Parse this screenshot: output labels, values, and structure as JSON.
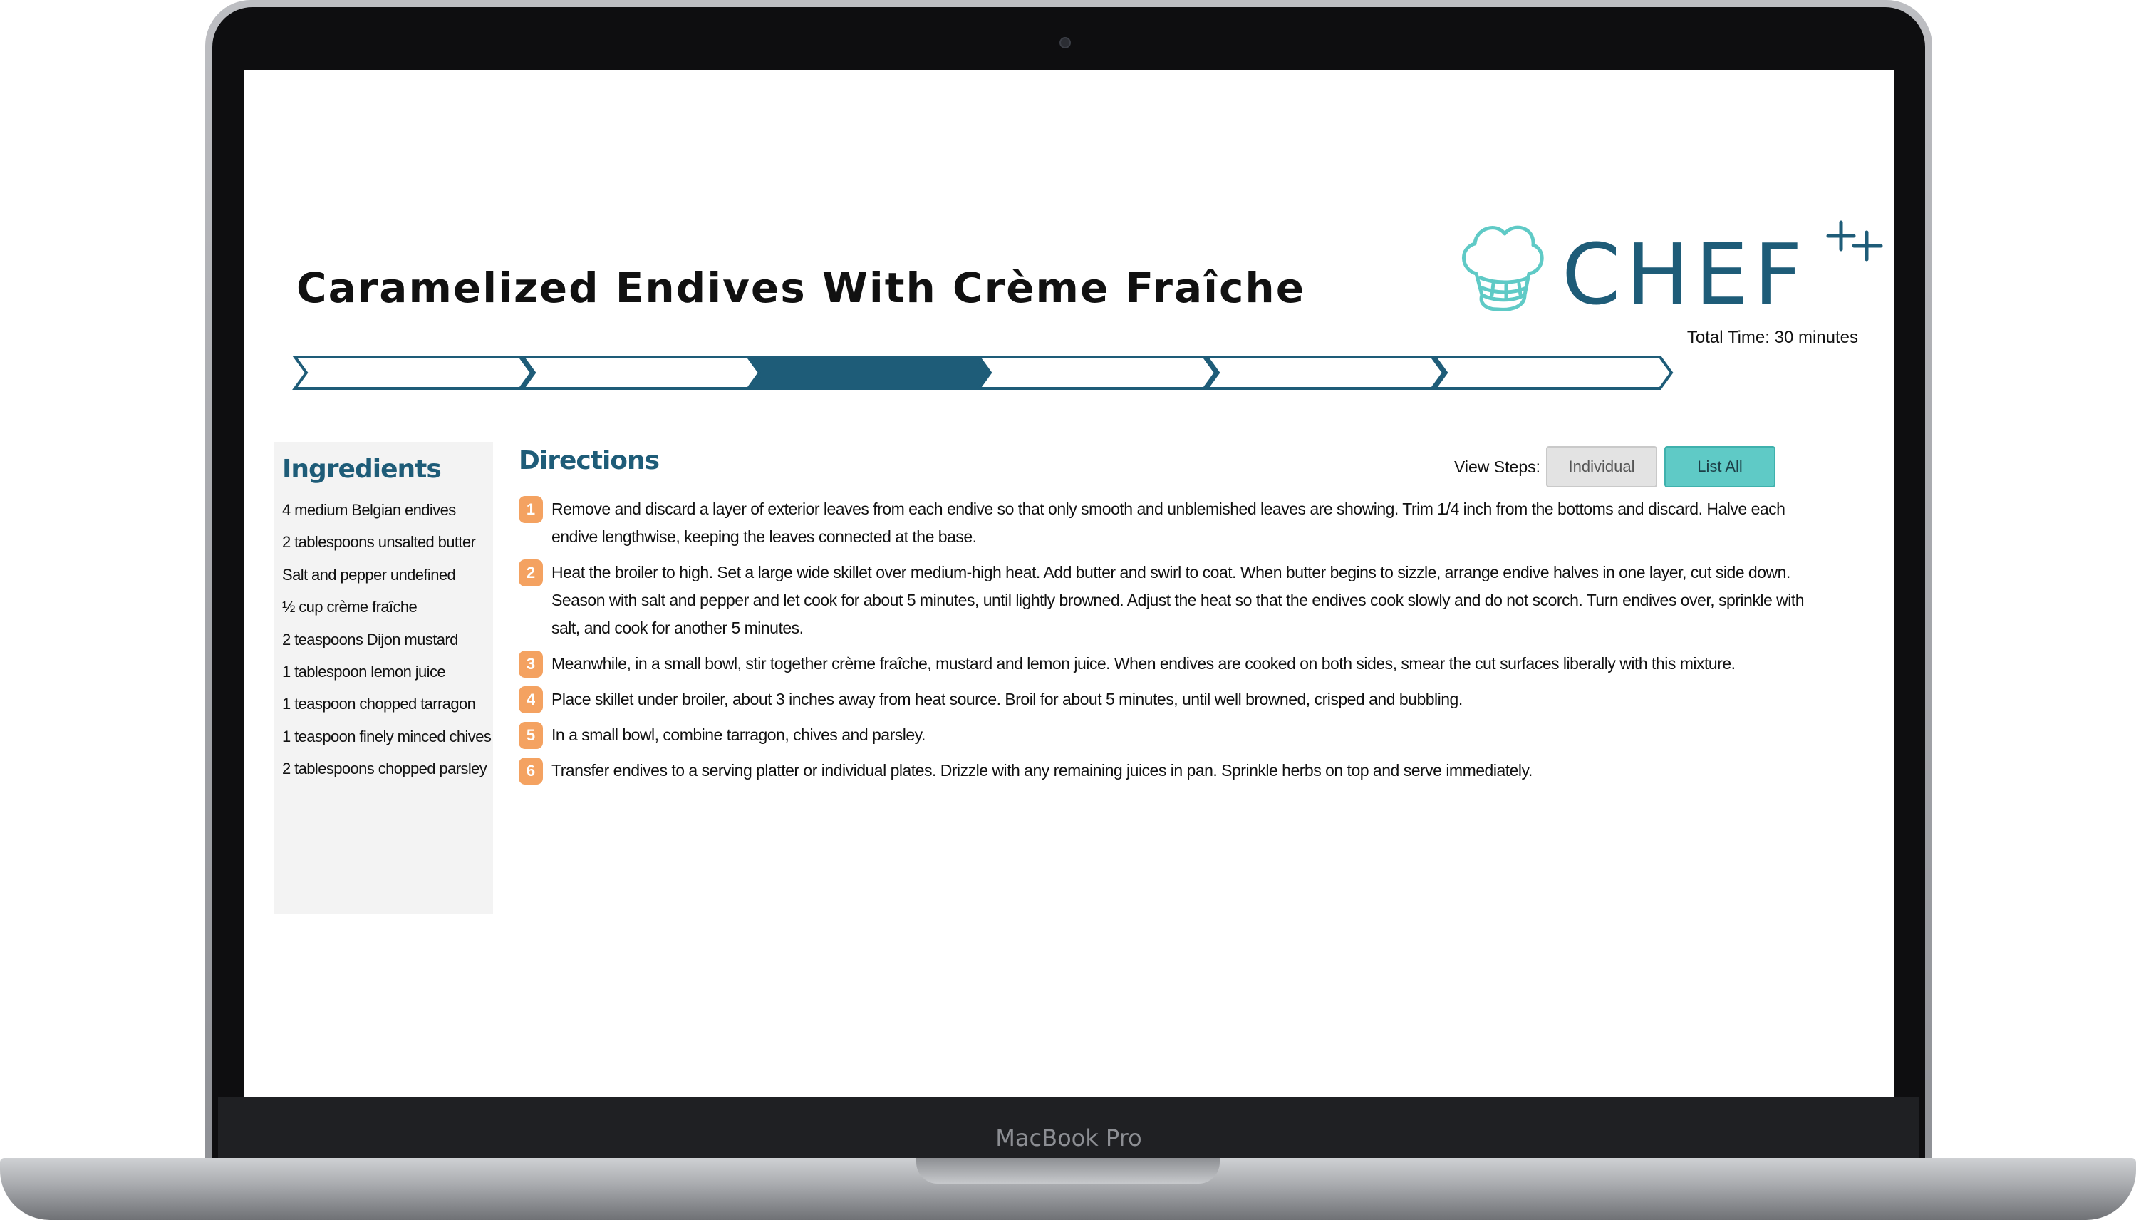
{
  "device": {
    "label": "MacBook Pro"
  },
  "recipe": {
    "title": "Caramelized Endives With Crème Fraîche",
    "total_time": "Total Time: 30 minutes",
    "progress": {
      "total_segments": 6,
      "active_segment": 3
    }
  },
  "logo": {
    "text": "CHEF",
    "suffix": "++",
    "hat_color": "#5fcac6",
    "text_color": "#1e5c78"
  },
  "ingredients": {
    "title": "Ingredients",
    "items": [
      "4 medium Belgian endives",
      "2 tablespoons unsalted butter",
      "Salt and pepper undefined",
      "½ cup crème fraîche",
      "2 teaspoons Dijon mustard",
      "1 tablespoon lemon juice",
      "1 teaspoon chopped tarragon",
      "1 teaspoon finely minced chives",
      "2 tablespoons chopped parsley"
    ]
  },
  "directions": {
    "title": "Directions",
    "view_steps_label": "View Steps:",
    "individual_label": "Individual",
    "list_all_label": "List All",
    "steps": [
      {
        "num": "1",
        "text": "Remove and discard a layer of exterior leaves from each endive so that only smooth and unblemished leaves are showing. Trim 1/4 inch from the bottoms and discard. Halve each endive lengthwise, keeping the leaves connected at the base."
      },
      {
        "num": "2",
        "text": "Heat the broiler to high. Set a large wide skillet over medium-high heat. Add butter and swirl to coat. When butter begins to sizzle, arrange endive halves in one layer, cut side down. Season with salt and pepper and let cook for about 5 minutes, until lightly browned. Adjust the heat so that the endives cook slowly and do not scorch. Turn endives over, sprinkle with salt, and cook for another 5 minutes."
      },
      {
        "num": "3",
        "text": "Meanwhile, in a small bowl, stir together crème fraîche, mustard and lemon juice. When endives are cooked on both sides, smear the cut surfaces liberally with this mixture."
      },
      {
        "num": "4",
        "text": "Place skillet under broiler, about 3 inches away from heat source. Broil for about 5 minutes, until well browned, crisped and bubbling."
      },
      {
        "num": "5",
        "text": "In a small bowl, combine tarragon, chives and parsley."
      },
      {
        "num": "6",
        "text": "Transfer endives to a serving platter or individual plates. Drizzle with any remaining juices in pan. Sprinkle herbs on top and serve immediately."
      }
    ]
  },
  "colors": {
    "accent": "#1e5c78",
    "step_badge": "#f4a261",
    "list_all_button": "#5fcac6",
    "progress_active": "#1e5c78"
  },
  "icons": [
    "chef-hat-icon",
    "plus-plus-icon",
    "step-arrow-icon"
  ]
}
